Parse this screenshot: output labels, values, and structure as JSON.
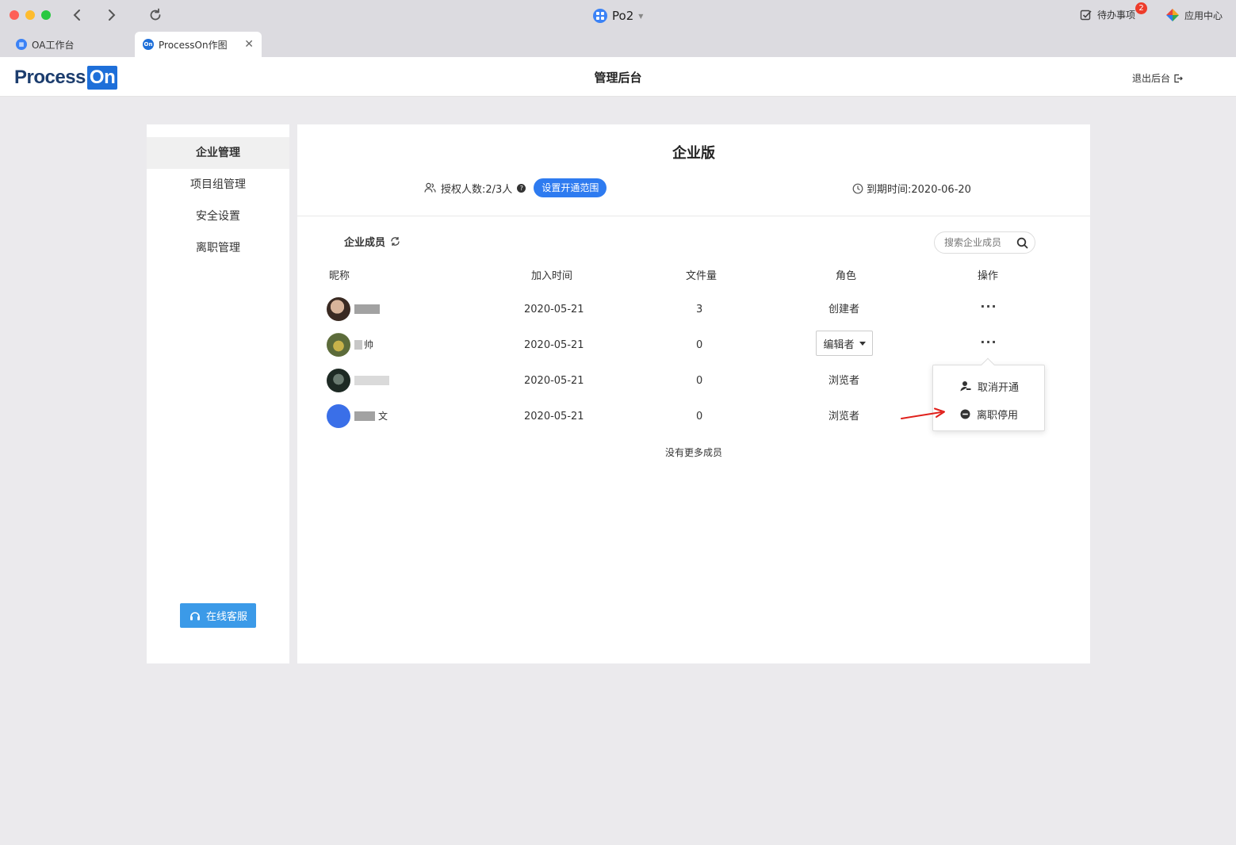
{
  "window": {
    "app_title": "Po2",
    "todo_label": "待办事项",
    "todo_count": "2",
    "app_center_label": "应用中心"
  },
  "tabs": [
    {
      "label": "OA工作台",
      "icon": "grid-icon",
      "color": "#3b82f6"
    },
    {
      "label": "ProcessOn作图",
      "icon": "processon-icon",
      "color": "#1e6fd9",
      "active": true
    }
  ],
  "header": {
    "logo_main": "Process",
    "logo_on": "On",
    "title": "管理后台",
    "logout_label": "退出后台"
  },
  "sidebar": {
    "items": [
      {
        "label": "企业管理",
        "active": true
      },
      {
        "label": "项目组管理"
      },
      {
        "label": "安全设置"
      },
      {
        "label": "离职管理"
      }
    ],
    "support_label": "在线客服"
  },
  "main": {
    "edition_title": "企业版",
    "auth_label": "授权人数:2/3人",
    "range_button": "设置开通范围",
    "expire_label": "到期时间:2020-06-20",
    "members_title": "企业成员",
    "search_placeholder": "搜索企业成员",
    "columns": [
      "昵称",
      "加入时间",
      "文件量",
      "角色",
      "操作"
    ],
    "rows": [
      {
        "nickname": "",
        "join_date": "2020-05-21",
        "files": "3",
        "role": "创建者"
      },
      {
        "nickname": "帅",
        "join_date": "2020-05-21",
        "files": "0",
        "role": "编辑者",
        "role_editable": true
      },
      {
        "nickname": "",
        "join_date": "2020-05-21",
        "files": "0",
        "role": "浏览者"
      },
      {
        "nickname": "文",
        "join_date": "2020-05-21",
        "files": "0",
        "role": "浏览者"
      }
    ],
    "more_label": "···",
    "no_more": "没有更多成员"
  },
  "popover": {
    "items": [
      {
        "label": "取消开通",
        "icon": "user-remove-icon"
      },
      {
        "label": "离职停用",
        "icon": "minus-circle-icon"
      }
    ]
  },
  "colors": {
    "accent": "#2e7bf0",
    "support": "#3b9ae8",
    "badge": "#ee3c2b",
    "annotation": "#e0201b"
  }
}
